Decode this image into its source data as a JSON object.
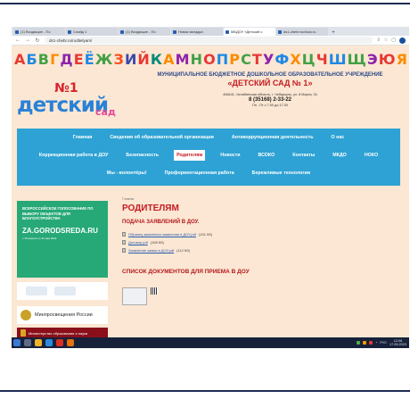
{
  "browser": {
    "tabs": [
      {
        "label": "(1) Входящие - По",
        "active": false
      },
      {
        "label": "Слайд 1",
        "active": false
      },
      {
        "label": "(1) Входящие - По",
        "active": false
      },
      {
        "label": "Новая вкладка",
        "active": false
      },
      {
        "label": "МБДОУ «Детский с",
        "active": true
      },
      {
        "label": "ds1-chebr.ru/docs.ru",
        "active": false
      }
    ],
    "new_tab": "+",
    "back": "←",
    "forward": "→",
    "reload": "↻",
    "url": "ds1-chebr.ru/roditelyam/"
  },
  "site": {
    "alphabet": [
      {
        "ch": "А",
        "color": "#e53935"
      },
      {
        "ch": "Б",
        "color": "#1e88e5"
      },
      {
        "ch": "В",
        "color": "#43a047"
      },
      {
        "ch": "Г",
        "color": "#fb8c00"
      },
      {
        "ch": "Д",
        "color": "#8e24aa"
      },
      {
        "ch": "Е",
        "color": "#e53935"
      },
      {
        "ch": "Ё",
        "color": "#1e88e5"
      },
      {
        "ch": "Ж",
        "color": "#43a047"
      },
      {
        "ch": "З",
        "color": "#f4511e"
      },
      {
        "ch": "И",
        "color": "#3949ab"
      },
      {
        "ch": "Й",
        "color": "#e53935"
      },
      {
        "ch": "К",
        "color": "#00897b"
      },
      {
        "ch": "А",
        "color": "#fb8c00"
      },
      {
        "ch": "М",
        "color": "#8e24aa"
      },
      {
        "ch": "Н",
        "color": "#43a047"
      },
      {
        "ch": "О",
        "color": "#e53935"
      },
      {
        "ch": "П",
        "color": "#1e88e5"
      },
      {
        "ch": "Р",
        "color": "#fb8c00"
      },
      {
        "ch": "С",
        "color": "#43a047"
      },
      {
        "ch": "Т",
        "color": "#e53935"
      },
      {
        "ch": "У",
        "color": "#8e24aa"
      },
      {
        "ch": "Ф",
        "color": "#1e88e5"
      },
      {
        "ch": "Х",
        "color": "#fb8c00"
      },
      {
        "ch": "Ц",
        "color": "#43a047"
      },
      {
        "ch": "Ч",
        "color": "#e53935"
      },
      {
        "ch": "Ш",
        "color": "#1e88e5"
      },
      {
        "ch": "Щ",
        "color": "#43a047"
      },
      {
        "ch": "Э",
        "color": "#8e24aa"
      },
      {
        "ch": "Ю",
        "color": "#e53935"
      },
      {
        "ch": "Я",
        "color": "#fb8c00"
      }
    ],
    "org_line1": "МУНИЦИПАЛЬНОЕ БЮДЖЕТНОЕ ДОШКОЛЬНОЕ ОБРАЗОВАТЕЛЬНОЕ УЧРЕЖДЕНИЕ",
    "org_line2": "«ДЕТСКИЙ САД № 1»",
    "address": "456441, Челябинская область, г. Чебаркуль, ул. 8 Марта, 34",
    "phone": "8 (35168) 2-33-22",
    "hours": "Пн - Пт с 7:00 до 17:30",
    "logo_no": "№1",
    "logo_word": "детский",
    "logo_sad": "сад",
    "menu": [
      [
        "Главная",
        "Сведения об образовательной организации",
        "Антикоррупционная деятельность",
        "О нас"
      ],
      [
        "Коррекционная работа в ДОУ",
        "Безопасность",
        "Родителям",
        "Новости",
        "ВСОКО",
        "Контакты",
        "МКДО",
        "НОКО"
      ],
      [
        "Мы - волонтёры!",
        "Профориентационная работа",
        "Бережливые технологии"
      ]
    ],
    "active_menu": "Родителям",
    "vote_banner": {
      "text": "ВСЕРОССИЙСКОЕ ГОЛОСОВАНИЕ ПО ВЫБОРУ ОБЪЕКТОВ ДЛЯ БЛАГОУСТРОЙСТВА",
      "site": "ZA.GORODSREDA.RU",
      "dates": "с 15 апреля по 31 мая 2024"
    },
    "minpros": "Минпросвещения России",
    "edu_ministry": "Министерство образования и науки"
  },
  "content": {
    "breadcrumb": "Главная",
    "title": "РОДИТЕЛЯМ",
    "section1": "ПОДАЧА ЗАЯВЛЕНИЙ В ДОУ.",
    "docs": [
      {
        "label": "Образец заявления заявления в ДОУ.pdf",
        "size": "(151 Кб)"
      },
      {
        "label": "Договор.pdf",
        "size": "(165 Кб)"
      },
      {
        "label": "Заявление заявы в ДОУ.pdf",
        "size": "(112 Кб)"
      }
    ],
    "section2": "СПИСОК ДОКУМЕНТОВ ДЛЯ ПРИЕМА В ДОУ"
  },
  "taskbar": {
    "lang": "РУС",
    "time": "12:06",
    "date": "17.05.2023"
  },
  "colors": {
    "menu_bg": "#2ea2d4",
    "accent_red": "#c51b23",
    "page_bg": "#fbe7d3",
    "taskbar_bg": "#17213a"
  }
}
